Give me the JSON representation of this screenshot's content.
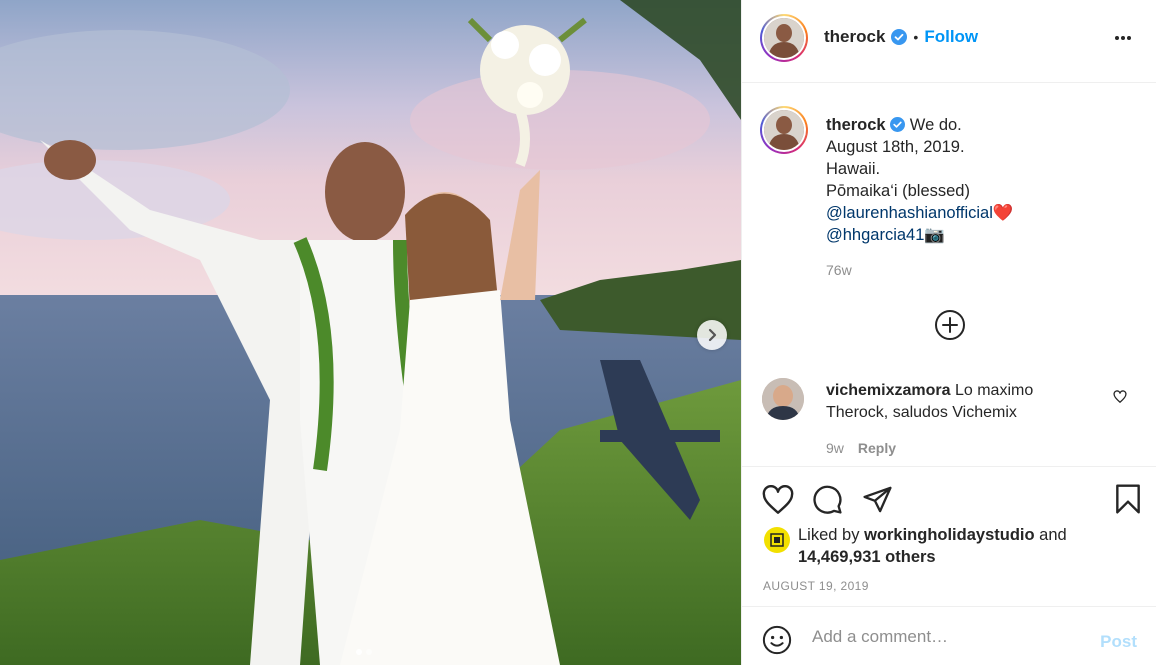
{
  "post": {
    "username": "therock",
    "follow_label": "Follow",
    "caption": {
      "lead": "We do.",
      "lines": [
        "August 18th, 2019.",
        "Hawaii.",
        "Pōmaika‘i (blessed)"
      ],
      "mention1": "@laurenhashianofficial",
      "mention1_emoji": "❤️",
      "mention2": "@hhgarcia41",
      "mention2_emoji": "📷"
    },
    "caption_age": "76w",
    "carousel": {
      "current": 1,
      "total": 2
    }
  },
  "comment": {
    "username": "vichemixzamora",
    "text": "Lo maximo Therock, saludos Vichemix",
    "age": "9w",
    "reply_label": "Reply"
  },
  "likes": {
    "prefix": "Liked by",
    "user": "workingholidaystudio",
    "and": "and",
    "others": "14,469,931 others"
  },
  "date": "AUGUST 19, 2019",
  "add_comment": {
    "placeholder": "Add a comment…",
    "post_label": "Post"
  },
  "colors": {
    "accent": "#0095f6",
    "verified": "#3897f0",
    "post_disabled": "#b2dffc",
    "liker_avatar": "#f2e000"
  },
  "icons": [
    "more-icon",
    "next-arrow-icon",
    "load-more-icon",
    "heart-icon",
    "comment-icon",
    "share-icon",
    "bookmark-icon",
    "emoji-icon",
    "verified-icon"
  ]
}
